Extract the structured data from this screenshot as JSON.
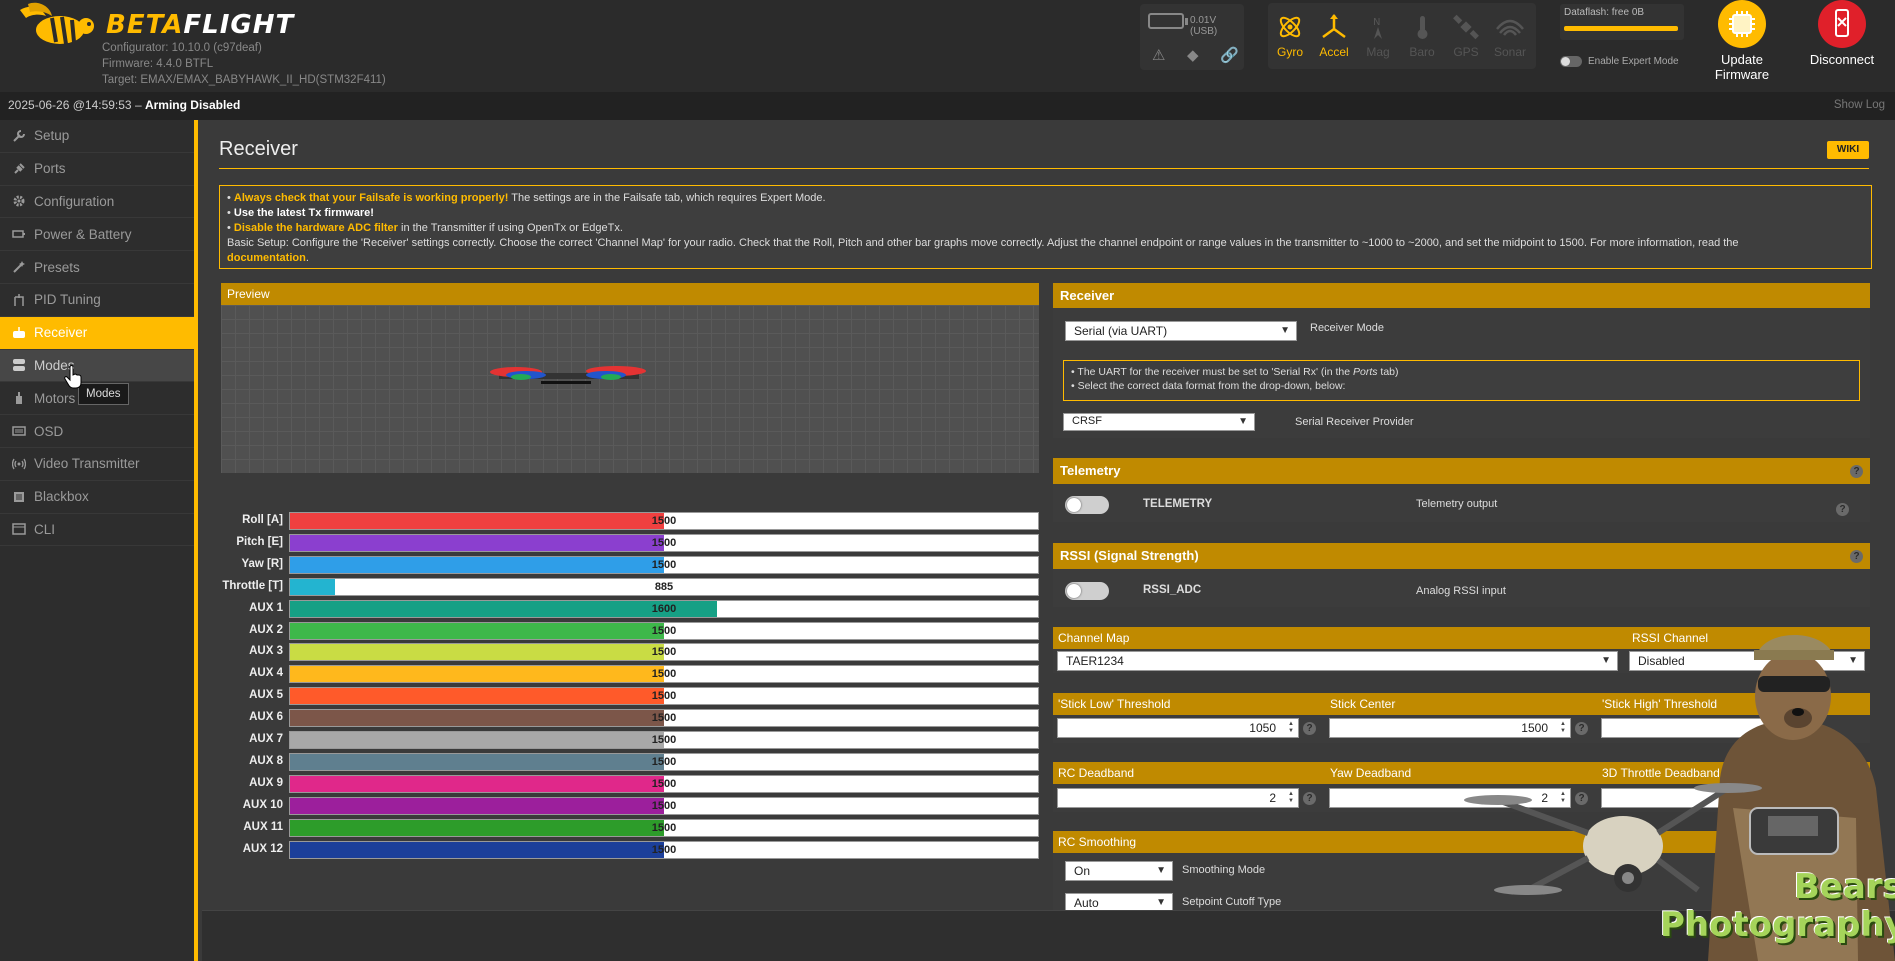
{
  "header": {
    "brand_part1": "BETA",
    "brand_part2": "FLIGHT",
    "configurator": "Configurator: 10.10.0 (c97deaf)",
    "firmware": "Firmware: 4.4.0 BTFL",
    "target": "Target: EMAX/EMAX_BABYHAWK_II_HD(STM32F411)",
    "battery": "0.01V (USB)",
    "sensors": [
      {
        "label": "Gyro",
        "state": "on"
      },
      {
        "label": "Accel",
        "state": "on"
      },
      {
        "label": "Mag",
        "state": "off"
      },
      {
        "label": "Baro",
        "state": "off"
      },
      {
        "label": "GPS",
        "state": "off"
      },
      {
        "label": "Sonar",
        "state": "off"
      }
    ],
    "dataflash": "Dataflash: free 0B",
    "expert_mode": "Enable Expert Mode",
    "update_line1": "Update",
    "update_line2": "Firmware",
    "disconnect": "Disconnect"
  },
  "status": {
    "date": "2025-06-26 @14:59:53 – ",
    "arming": "Arming Disabled",
    "show_log": "Show Log"
  },
  "sidebar": {
    "items": [
      {
        "label": "Setup",
        "icon": "wrench-icon"
      },
      {
        "label": "Ports",
        "icon": "plug-icon"
      },
      {
        "label": "Configuration",
        "icon": "gear-icon"
      },
      {
        "label": "Power & Battery",
        "icon": "battery-icon"
      },
      {
        "label": "Presets",
        "icon": "wand-icon"
      },
      {
        "label": "PID Tuning",
        "icon": "sliders-icon"
      },
      {
        "label": "Receiver",
        "icon": "gamepad-icon"
      },
      {
        "label": "Modes",
        "icon": "modes-icon"
      },
      {
        "label": "Motors",
        "icon": "motor-icon"
      },
      {
        "label": "OSD",
        "icon": "osd-icon"
      },
      {
        "label": "Video Transmitter",
        "icon": "antenna-icon"
      },
      {
        "label": "Blackbox",
        "icon": "blackbox-icon"
      },
      {
        "label": "CLI",
        "icon": "terminal-icon"
      }
    ],
    "active": "Receiver",
    "hovered": "Modes",
    "tooltip": "Modes"
  },
  "page": {
    "title": "Receiver",
    "wiki": "WIKI",
    "notice": {
      "l1_bold": "Always check that your Failsafe is working properly!",
      "l1_rest": " The settings are in the Failsafe tab, which requires Expert Mode.",
      "l2": "Use the latest Tx firmware!",
      "l3_bold": "Disable the hardware ADC filter",
      "l3_rest": " in the Transmitter if using OpenTx or EdgeTx.",
      "l4": "Basic Setup: Configure the 'Receiver' settings correctly. Choose the correct 'Channel Map' for your radio. Check that the Roll, Pitch and other bar graphs move correctly. Adjust the channel endpoint or range values in the transmitter to ~1000 to ~2000, and set the midpoint to 1500. For more information, read the",
      "l5_link": "documentation",
      "l5_rest": "."
    }
  },
  "preview": {
    "title": "Preview"
  },
  "channels": [
    {
      "label": "Roll [A]",
      "value": 1500,
      "color": "#f04040"
    },
    {
      "label": "Pitch [E]",
      "value": 1500,
      "color": "#8b3fcf"
    },
    {
      "label": "Yaw [R]",
      "value": 1500,
      "color": "#2f9ee8"
    },
    {
      "label": "Throttle [T]",
      "value": 885,
      "color": "#23b4d0"
    },
    {
      "label": "AUX 1",
      "value": 1600,
      "color": "#16a085"
    },
    {
      "label": "AUX 2",
      "value": 1500,
      "color": "#3eb84a"
    },
    {
      "label": "AUX 3",
      "value": 1500,
      "color": "#c9dc44"
    },
    {
      "label": "AUX 4",
      "value": 1500,
      "color": "#ffb81c"
    },
    {
      "label": "AUX 5",
      "value": 1500,
      "color": "#ff5a2a"
    },
    {
      "label": "AUX 6",
      "value": 1500,
      "color": "#7c5649"
    },
    {
      "label": "AUX 7",
      "value": 1500,
      "color": "#a8a8a8"
    },
    {
      "label": "AUX 8",
      "value": 1500,
      "color": "#5f7f8f"
    },
    {
      "label": "AUX 9",
      "value": 1500,
      "color": "#e0288a"
    },
    {
      "label": "AUX 10",
      "value": 1500,
      "color": "#9c1f9c"
    },
    {
      "label": "AUX 11",
      "value": 1500,
      "color": "#2d9c2a"
    },
    {
      "label": "AUX 12",
      "value": 1500,
      "color": "#1c3f9a"
    }
  ],
  "receiver": {
    "title": "Receiver",
    "mode_value": "Serial (via UART)",
    "mode_label": "Receiver Mode",
    "note_l1a": "The UART for the receiver must be set to 'Serial Rx' (in the ",
    "note_l1b": "Ports",
    "note_l1c": " tab)",
    "note_l2": "Select the correct data format from the drop-down, below:",
    "provider_value": "CRSF",
    "provider_label": "Serial Receiver Provider"
  },
  "telemetry": {
    "title": "Telemetry",
    "name": "TELEMETRY",
    "desc": "Telemetry output"
  },
  "rssi": {
    "title": "RSSI (Signal Strength)",
    "name": "RSSI_ADC",
    "desc": "Analog RSSI input"
  },
  "channel_map": {
    "label": "Channel Map",
    "value": "TAER1234",
    "rssi_label": "RSSI Channel",
    "rssi_value": "Disabled"
  },
  "thresholds": {
    "low_label": "'Stick Low' Threshold",
    "low_value": "1050",
    "center_label": "Stick Center",
    "center_value": "1500",
    "high_label": "'Stick High' Threshold"
  },
  "deadband": {
    "rc_label": "RC Deadband",
    "rc_value": "2",
    "yaw_label": "Yaw Deadband",
    "yaw_value": "2",
    "throttle_label": "3D Throttle Deadband"
  },
  "smoothing": {
    "title": "RC Smoothing",
    "mode_value": "On",
    "mode_label": "Smoothing Mode",
    "cutoff_value": "Auto",
    "cutoff_label": "Setpoint Cutoff Type"
  },
  "watermark": {
    "line1": "Bears",
    "line2": "Photography"
  },
  "colors": {
    "accent": "#ffbb00",
    "panel_header": "#c08a00",
    "disconnect": "#e0202a"
  }
}
